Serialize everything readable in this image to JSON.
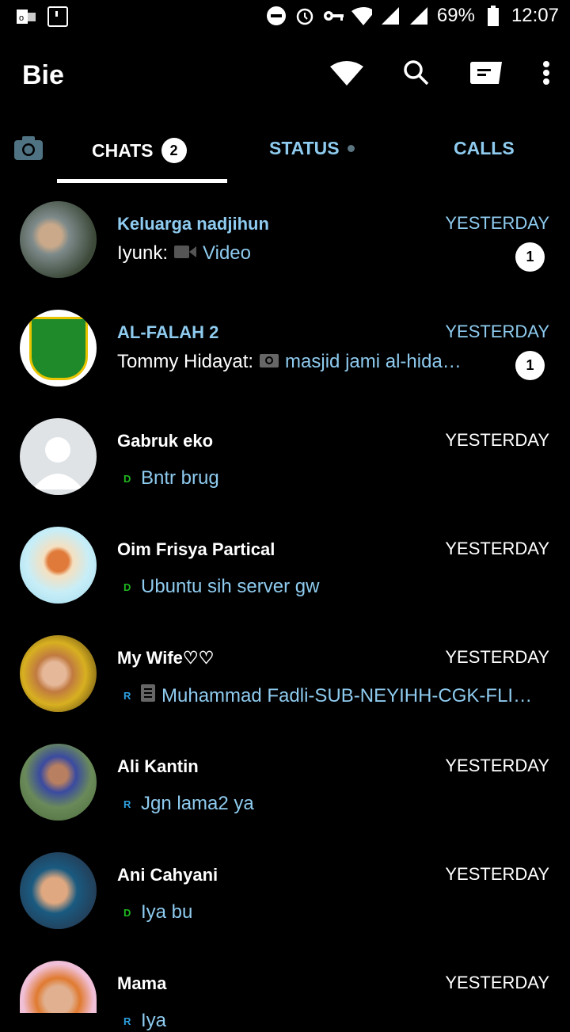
{
  "status_bar": {
    "battery": "69%",
    "time": "12:07",
    "icons": [
      "outlook-icon",
      "notification-icon",
      "dnd-icon",
      "alarm-icon",
      "vpn-key-icon",
      "wifi-icon",
      "signal-icon",
      "signal-icon",
      "battery-icon"
    ]
  },
  "app_bar": {
    "title": "Bie",
    "icons": [
      "wifi-icon",
      "search-icon",
      "new-chat-icon",
      "more-icon"
    ]
  },
  "tabs": [
    {
      "label": "CHATS",
      "badge": "2"
    },
    {
      "label": "STATUS"
    },
    {
      "label": "CALLS"
    }
  ],
  "colors": {
    "accent": "#8ecbef",
    "delivered": "#1fb81f",
    "read": "#2ea0e0"
  },
  "chats": [
    {
      "name": "Keluarga nadjihun",
      "time": "YESTERDAY",
      "sender": "Iyunk:",
      "media": "Video",
      "unread": "1"
    },
    {
      "name": "AL-FALAH 2",
      "time": "YESTERDAY",
      "sender": "Tommy Hidayat:",
      "media": "masjid jami al-hida…",
      "unread": "1"
    },
    {
      "name": "Gabruk eko",
      "time": "YESTERDAY",
      "tick": "D",
      "message": "Bntr brug"
    },
    {
      "name": "Oim Frisya Partical",
      "time": "YESTERDAY",
      "tick": "D",
      "message": "Ubuntu sih server gw"
    },
    {
      "name": "My Wife♡♡",
      "time": "YESTERDAY",
      "tick": "R",
      "message": "Muhammad Fadli-SUB-NEYIHH-CGK-FLIGHT_…"
    },
    {
      "name": "Ali Kantin",
      "time": "YESTERDAY",
      "tick": "R",
      "message": "Jgn lama2 ya"
    },
    {
      "name": "Ani Cahyani",
      "time": "YESTERDAY",
      "tick": "D",
      "message": "Iya bu"
    },
    {
      "name": "Mama",
      "time": "YESTERDAY",
      "tick": "R",
      "message": "Iya"
    }
  ]
}
